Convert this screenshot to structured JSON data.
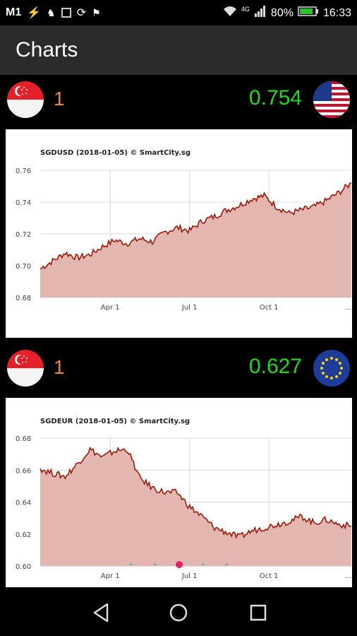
{
  "status_bar": {
    "carrier": "M1",
    "network": "4G",
    "battery": "80%",
    "time": "16:33"
  },
  "app_bar": {
    "title": "Charts"
  },
  "pairs": [
    {
      "base_qty": "1",
      "rate": "0.754",
      "base_flag": "singapore-flag-icon",
      "quote_flag": "usa-flag-icon"
    },
    {
      "base_qty": "1",
      "rate": "0.627",
      "base_flag": "singapore-flag-icon",
      "quote_flag": "eu-flag-icon"
    }
  ],
  "colors": {
    "qty": "#f08c1e",
    "rate": "#22d81a",
    "line": "#9b1a0c",
    "fill": "#e3b6b0"
  },
  "chart_data": [
    {
      "type": "area",
      "title": "SGDUSD (2018-01-05) © SmartCity.sg",
      "x_ticks": [
        "Apr 1",
        "Jul 1",
        "Oct 1",
        "..."
      ],
      "y_ticks": [
        "0.76",
        "0.74",
        "0.72",
        "0.70",
        "0.68"
      ],
      "ylim": [
        0.68,
        0.76
      ],
      "grid": true,
      "series": [
        {
          "x": [
            "Jan 5",
            "Jan 20",
            "Feb 5",
            "Feb 20",
            "Mar 5",
            "Mar 20",
            "Apr 1",
            "Apr 15",
            "May 1",
            "May 15",
            "Jun 1",
            "Jun 15",
            "Jul 1",
            "Jul 15",
            "Aug 1",
            "Aug 15",
            "Sep 1",
            "Sep 15",
            "Oct 1",
            "Oct 15",
            "Nov 1",
            "Nov 15",
            "Dec 1",
            "Dec 15",
            "Jan 1",
            "Jan 5"
          ],
          "values": [
            0.698,
            0.703,
            0.708,
            0.705,
            0.707,
            0.712,
            0.716,
            0.714,
            0.717,
            0.715,
            0.721,
            0.724,
            0.722,
            0.728,
            0.731,
            0.735,
            0.738,
            0.742,
            0.744,
            0.737,
            0.733,
            0.735,
            0.737,
            0.741,
            0.746,
            0.752
          ]
        }
      ]
    },
    {
      "type": "area",
      "title": "SGDEUR (2018-01-05) © SmartCity.sg",
      "x_ticks": [
        "Apr 1",
        "Jul 1",
        "Oct 1",
        "..."
      ],
      "y_ticks": [
        "0.68",
        "0.66",
        "0.64",
        "0.62",
        "0.60"
      ],
      "ylim": [
        0.6,
        0.68
      ],
      "grid": true,
      "series": [
        {
          "x": [
            "Jan 5",
            "Jan 20",
            "Feb 5",
            "Feb 20",
            "Mar 5",
            "Mar 20",
            "Apr 1",
            "Apr 15",
            "May 1",
            "May 15",
            "Jun 1",
            "Jun 15",
            "Jul 1",
            "Jul 15",
            "Aug 1",
            "Aug 15",
            "Sep 1",
            "Sep 15",
            "Oct 1",
            "Oct 15",
            "Nov 1",
            "Nov 15",
            "Dec 1",
            "Dec 15",
            "Jan 1",
            "Jan 5"
          ],
          "values": [
            0.661,
            0.658,
            0.656,
            0.664,
            0.673,
            0.668,
            0.672,
            0.673,
            0.655,
            0.649,
            0.646,
            0.646,
            0.637,
            0.631,
            0.624,
            0.621,
            0.618,
            0.622,
            0.624,
            0.626,
            0.628,
            0.631,
            0.627,
            0.629,
            0.626,
            0.625
          ]
        }
      ]
    }
  ]
}
